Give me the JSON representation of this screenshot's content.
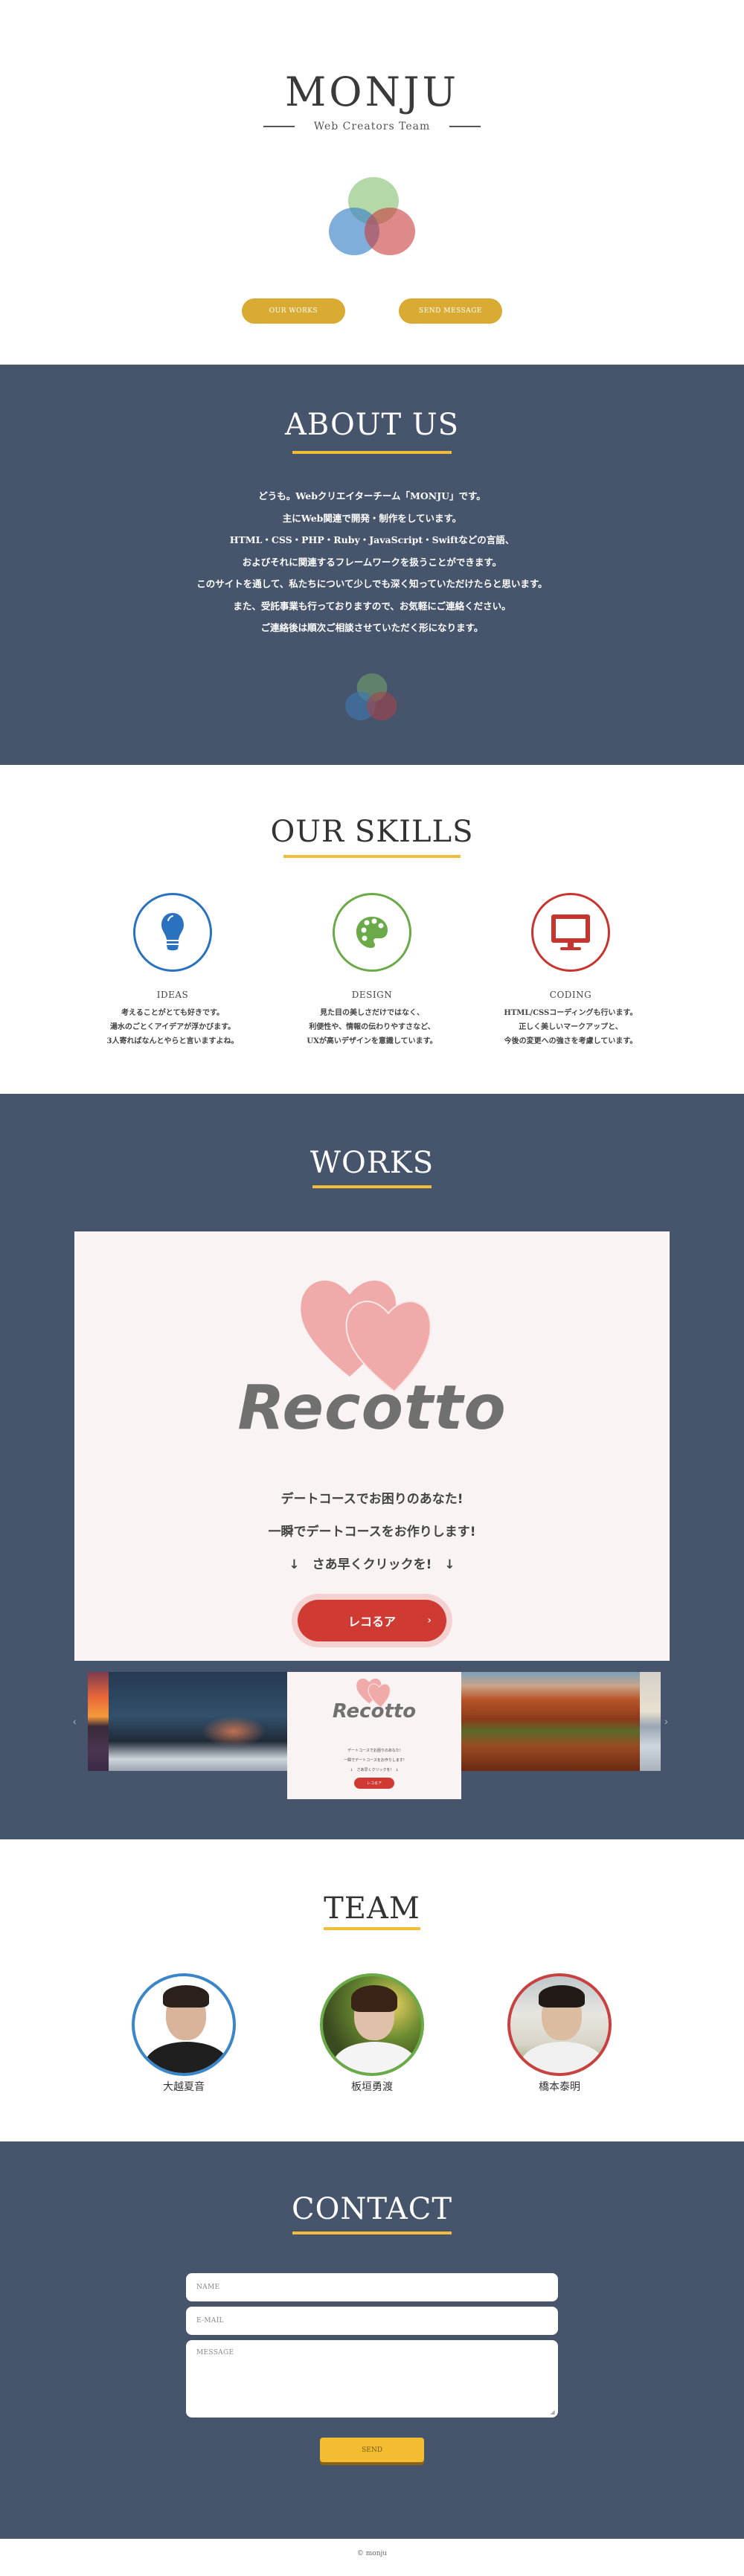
{
  "hero": {
    "logo": "MONJU",
    "tagline": "Web Creators Team",
    "buttons": {
      "works": "OUR WORKS",
      "send": "SEND MESSAGE"
    }
  },
  "about": {
    "title": "ABOUT US",
    "lines": [
      "どうも。Webクリエイターチーム「MONJU」です。",
      "主にWeb関連で開発・制作をしています。",
      "HTML・CSS・PHP・Ruby・JavaScript・Swiftなどの言語、",
      "およびそれに関連するフレームワークを扱うことができます。",
      "このサイトを通して、私たちについて少しでも深く知っていただけたらと思います。",
      "また、受託事業も行っておりますので、お気軽にご連絡ください。",
      "ご連絡後は順次ご相談させていただく形になります。"
    ]
  },
  "skills": {
    "title": "OUR SKILLS",
    "items": [
      {
        "name": "IDEAS",
        "icon": "lightbulb-icon",
        "color": "#2a72c0",
        "desc": [
          "考えることがとても好きです。",
          "湯水のごとくアイデアが浮かびます。",
          "3人寄ればなんとやらと言いますよね。"
        ]
      },
      {
        "name": "DESIGN",
        "icon": "palette-icon",
        "color": "#6aaa48",
        "desc": [
          "見た目の美しさだけではなく、",
          "利便性や、情報の伝わりやすさなど、",
          "UXが高いデザインを意識しています。"
        ]
      },
      {
        "name": "CODING",
        "icon": "monitor-icon",
        "color": "#c8342e",
        "desc": [
          "HTML/CSSコーディングも行います。",
          "正しく美しいマークアップと、",
          "今後の変更への強さを考慮しています。"
        ]
      }
    ]
  },
  "works": {
    "title": "WORKS",
    "main_slide": {
      "brand": "Recotto",
      "lines": [
        "デートコースでお困りのあなた!",
        "一瞬でデートコースをお作りします!",
        "↓　さあ早くクリックを!　↓"
      ],
      "cta": "レコるア",
      "cta_arrow": "›"
    },
    "carousel": {
      "prev": "‹",
      "next": "›",
      "thumbnails": [
        "sunset-photo",
        "starry-night-mountain-photo",
        "recotto-screenshot",
        "canyon-photo",
        "snow-mountain-photo"
      ]
    }
  },
  "team": {
    "title": "TEAM",
    "members": [
      {
        "name": "大越夏音",
        "color": "#3a86c8"
      },
      {
        "name": "板垣勇渡",
        "color": "#6aaa48"
      },
      {
        "name": "橋本泰明",
        "color": "#c84040"
      }
    ]
  },
  "contact": {
    "title": "CONTACT",
    "name_placeholder": "NAME",
    "email_placeholder": "E-MAIL",
    "message_placeholder": "MESSAGE",
    "send": "SEND"
  },
  "footer": {
    "copyright": "© monju"
  },
  "colors": {
    "dark_bg": "#46556c",
    "accent_yellow": "#f0bd3a",
    "button_gold": "#d9ab33"
  }
}
